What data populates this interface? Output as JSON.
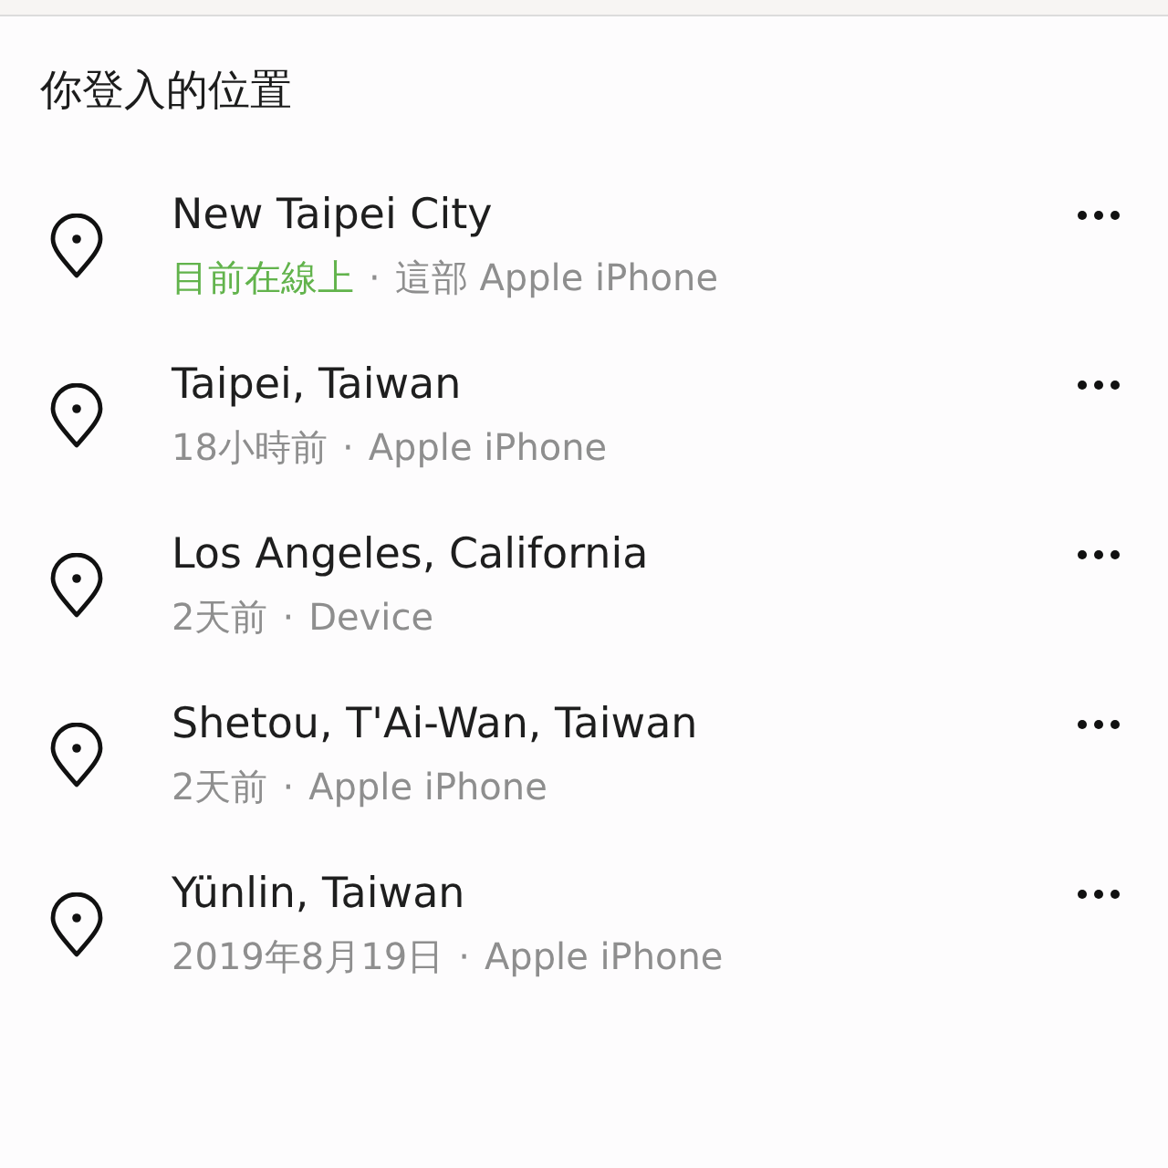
{
  "heading": "你登入的位置",
  "locations": [
    {
      "place": "New Taipei City",
      "when": "目前在線上",
      "online": true,
      "separator": "·",
      "device": "這部 Apple iPhone"
    },
    {
      "place": "Taipei, Taiwan",
      "when": "18小時前",
      "online": false,
      "separator": "·",
      "device": "Apple iPhone"
    },
    {
      "place": "Los Angeles, California",
      "when": "2天前",
      "online": false,
      "separator": "·",
      "device": "Device"
    },
    {
      "place": "Shetou, T'Ai-Wan, Taiwan",
      "when": "2天前",
      "online": false,
      "separator": "·",
      "device": "Apple iPhone"
    },
    {
      "place": "Yünlin, Taiwan",
      "when": "2019年8月19日",
      "online": false,
      "separator": "·",
      "device": "Apple iPhone"
    }
  ]
}
